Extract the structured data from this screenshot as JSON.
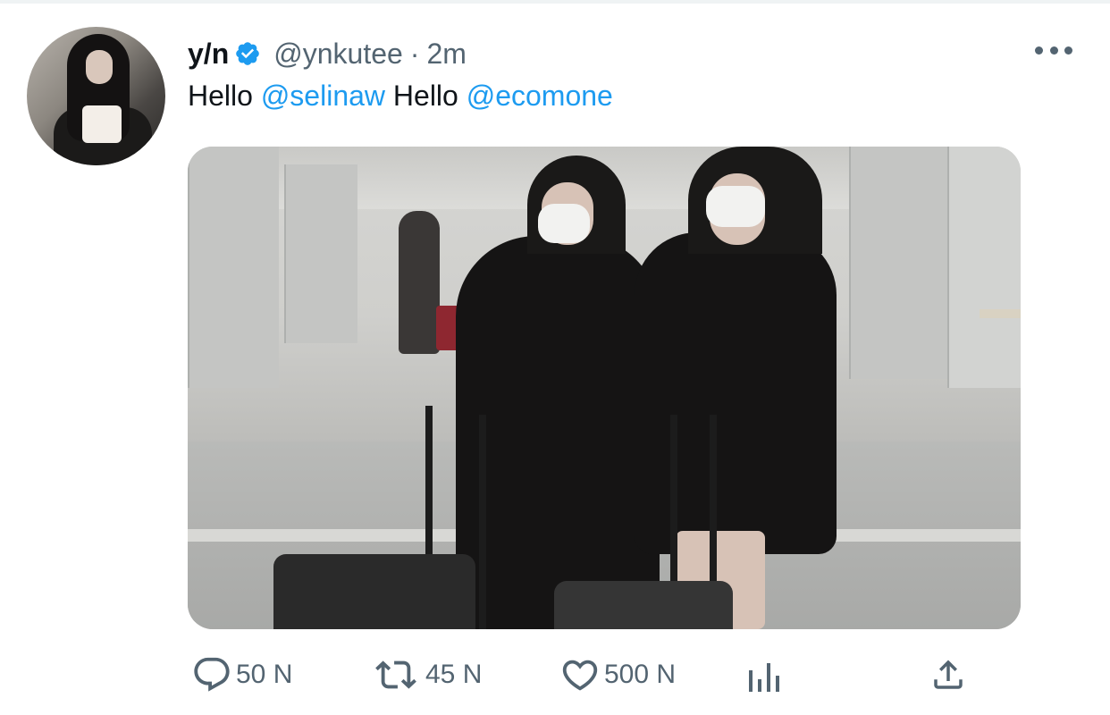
{
  "tweet": {
    "display_name": "y/n",
    "handle": "@ynkutee",
    "separator": "·",
    "time": "2m",
    "text_parts": {
      "hello_1": "Hello",
      "mention_1": "@selinaw",
      "hello_2": "Hello",
      "mention_2": "@ecomone"
    }
  },
  "actions": {
    "reply_count": "50 N",
    "retweet_count": "45 N",
    "like_count": "500 N"
  },
  "icons": {
    "verified": "verified-badge-icon",
    "more": "more-options-icon",
    "reply": "reply-icon",
    "retweet": "retweet-icon",
    "like": "like-icon",
    "analytics": "analytics-icon",
    "share": "share-icon"
  },
  "colors": {
    "accent": "#1d9bf0",
    "text": "#0f1419",
    "muted": "#536471"
  }
}
